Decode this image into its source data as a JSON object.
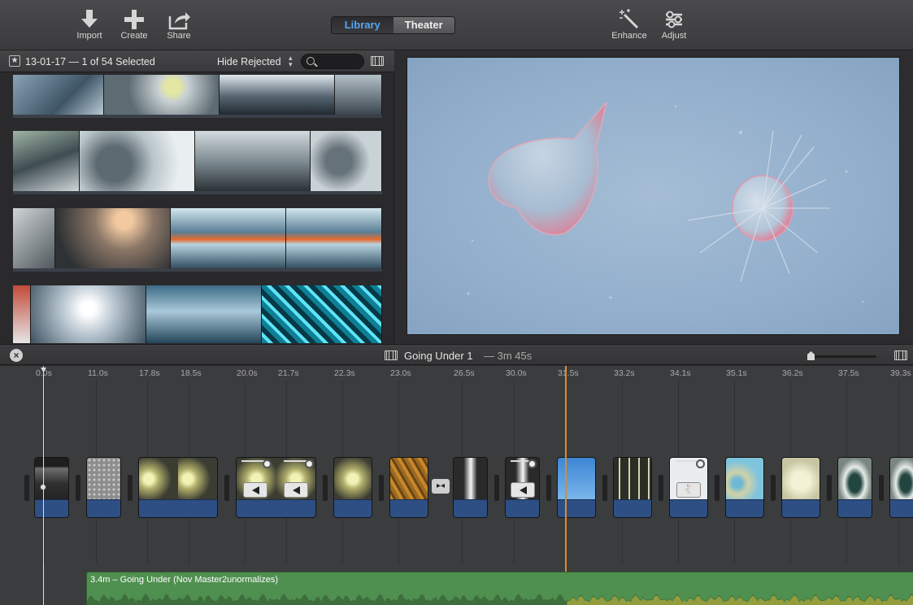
{
  "toolbar": {
    "import": "Import",
    "create": "Create",
    "share": "Share",
    "enhance": "Enhance",
    "adjust": "Adjust",
    "tabs": [
      "Library",
      "Theater"
    ],
    "active_tab": "Library"
  },
  "browser": {
    "event_label": "13-01-17 — 1 of 54 Selected",
    "filter": "Hide Rejected",
    "search_placeholder": ""
  },
  "project": {
    "title": "Going Under 1",
    "duration": "—  3m 45s"
  },
  "timeline": {
    "ticks": [
      "0.0s",
      "11.0s",
      "17.8s",
      "18.5s",
      "20.0s",
      "21.7s",
      "22.3s",
      "23.0s",
      "26.5s",
      "30.0s",
      "31.5s",
      "33.2s",
      "34.1s",
      "35.1s",
      "36.2s",
      "37.5s",
      "39.3s"
    ],
    "music_label": "3.4m – Going Under (Nov Master2unormalizes)"
  },
  "colors": {
    "accent": "#55a7f2",
    "playhead": "#e0892c",
    "music": "#4f8f4f",
    "audio_track": "#2e4f84"
  }
}
